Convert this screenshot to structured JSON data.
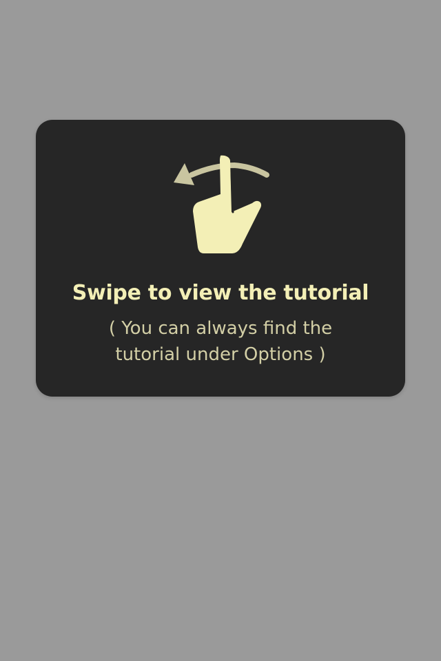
{
  "colors": {
    "page_background": "#9a9a9a",
    "card_background": "#262626",
    "accent": "#f3efb6",
    "secondary_text": "#d3cfa6",
    "arrow": "#c9c5a0"
  },
  "tutorial_prompt": {
    "icon": "swipe-gesture-icon",
    "title": "Swipe to view the tutorial",
    "subtitle_line_1": "( You can always find the",
    "subtitle_line_2": "tutorial under Options )"
  }
}
